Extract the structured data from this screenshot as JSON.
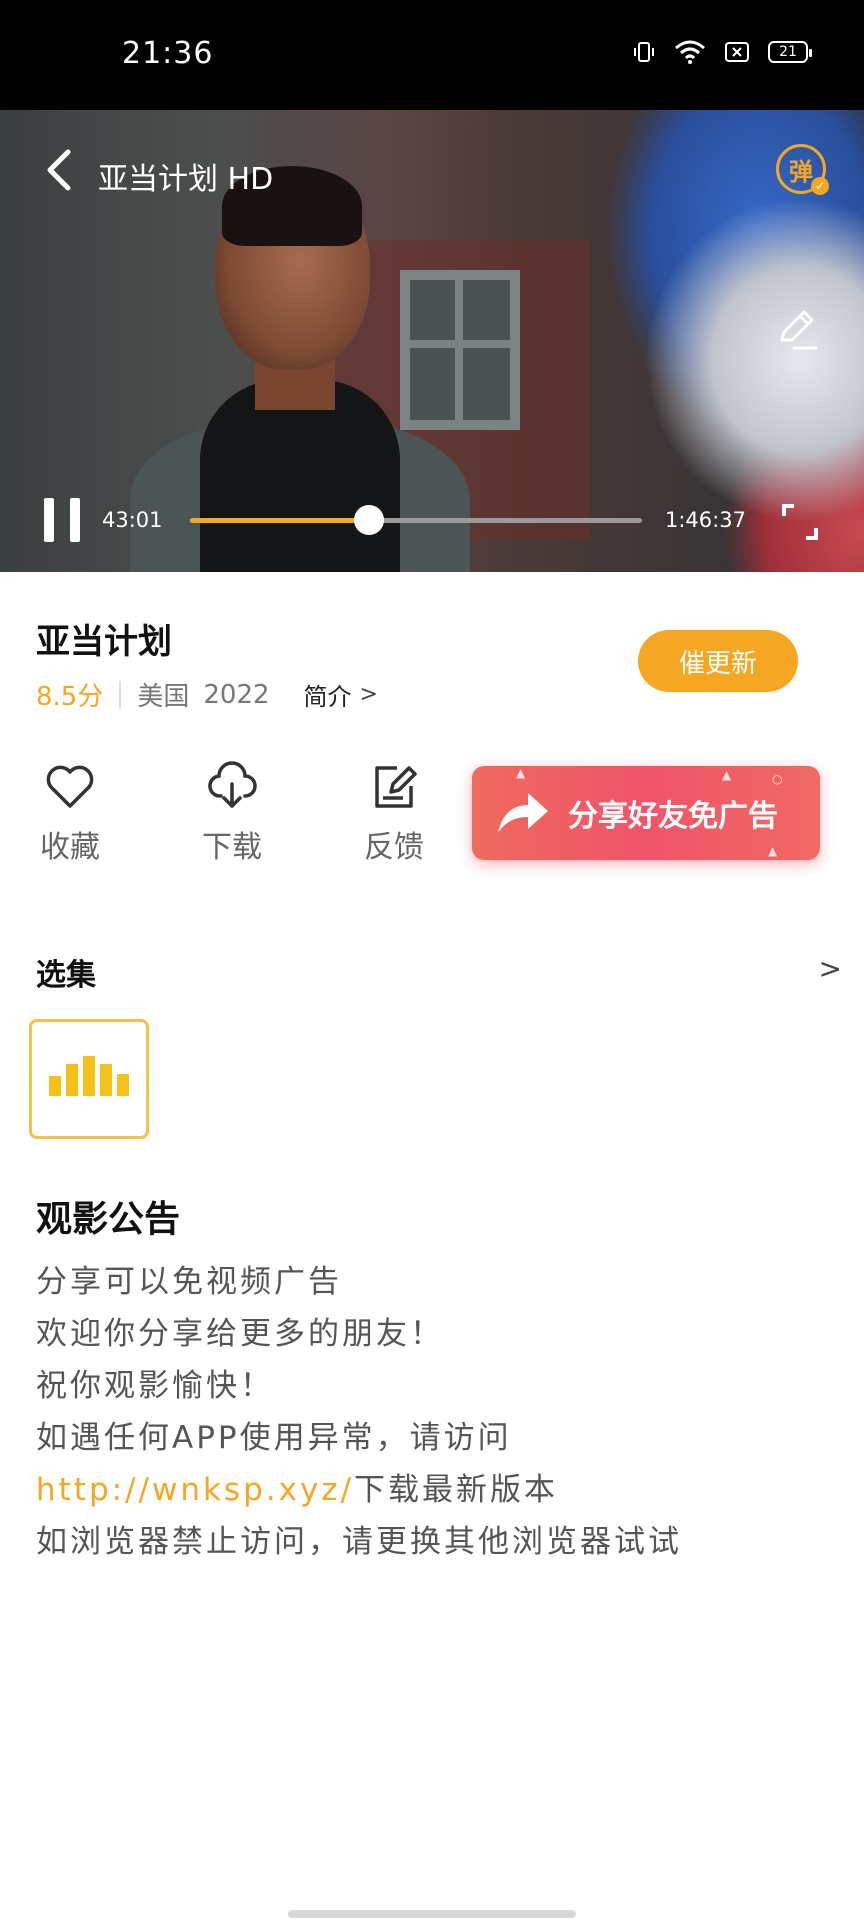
{
  "status_bar": {
    "time": "21:36",
    "battery": "21"
  },
  "player": {
    "title": "亚当计划 HD",
    "danmu_label": "弹",
    "time_current": "43:01",
    "time_total": "1:46:37",
    "progress_fraction": 0.395,
    "accent_color": "#f5a623"
  },
  "movie": {
    "title": "亚当计划",
    "rating": "8.5分",
    "country": "美国",
    "year": "2022",
    "intro_label": "简介",
    "update_button": "催更新"
  },
  "actions": {
    "favorite": "收藏",
    "download": "下载",
    "feedback": "反馈",
    "share": "分享好友免广告"
  },
  "episodes": {
    "title": "选集"
  },
  "notice": {
    "title": "观影公告",
    "line1": "分享可以免视频广告",
    "line2": "欢迎你分享给更多的朋友！",
    "line3": "祝你观影愉快！",
    "line4": "如遇任何APP使用异常，请访问",
    "link": "http://wnksp.xyz/",
    "line5_suffix": "下载最新版本",
    "line6": "如浏览器禁止访问，请更换其他浏览器试试"
  },
  "icons": {
    "back": "chevron-left-icon",
    "danmu": "danmu-toggle-icon",
    "edit": "pencil-icon",
    "pause": "pause-icon",
    "fullscreen": "fullscreen-icon",
    "favorite": "heart-icon",
    "download": "cloud-download-icon",
    "feedback": "edit-note-icon",
    "share": "share-arrow-icon",
    "playing": "equalizer-icon"
  }
}
